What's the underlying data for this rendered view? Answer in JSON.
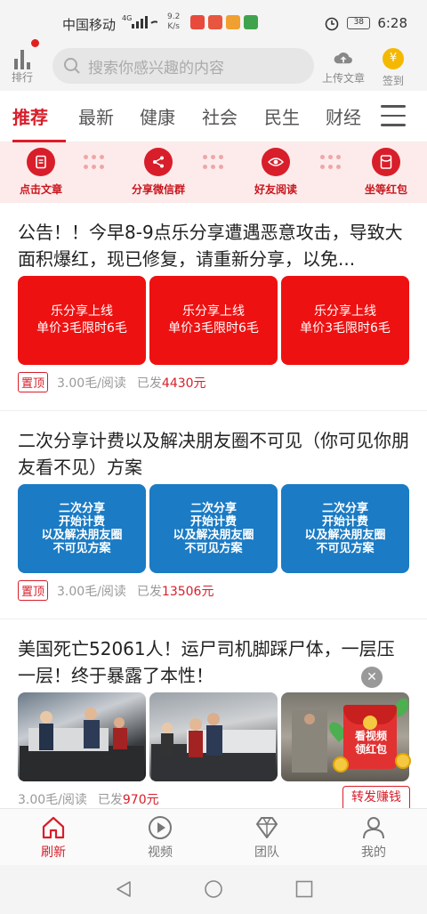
{
  "status_bar": {
    "carrier": "中国移动",
    "signal": "4G",
    "net_speed": "9.2",
    "net_unit": "K/s",
    "battery": "38",
    "time": "6:28"
  },
  "header": {
    "rank_label": "排行",
    "search_placeholder": "搜索你感兴趣的内容",
    "upload_label": "上传文章",
    "signin_label": "签到",
    "coin_symbol": "¥"
  },
  "tabs": [
    {
      "label": "推荐"
    },
    {
      "label": "最新"
    },
    {
      "label": "健康"
    },
    {
      "label": "社会"
    },
    {
      "label": "民生"
    },
    {
      "label": "财经"
    }
  ],
  "quick_actions": [
    {
      "label": "点击文章",
      "icon": "document-icon"
    },
    {
      "label": "分享微信群",
      "icon": "share-icon"
    },
    {
      "label": "好友阅读",
      "icon": "eye-icon"
    },
    {
      "label": "坐等红包",
      "icon": "redpacket-icon"
    }
  ],
  "articles": [
    {
      "title": "公告！！今早8-9点乐分享遭遇恶意攻击，导致大面积爆红，现已修复，请重新分享，以免...",
      "thumb_text": "乐分享上线\n单价3毛限时6毛",
      "pinned_label": "置顶",
      "price": "3.00毛/阅读",
      "paid_prefix": "已发",
      "paid_amount": "4430元"
    },
    {
      "title": "二次分享计费以及解决朋友圈不可见（你可见你朋友看不见）方案",
      "thumb_text": "二次分享\n开始计费\n以及解决朋友圈\n不可见方案",
      "pinned_label": "置顶",
      "price": "3.00毛/阅读",
      "paid_prefix": "已发",
      "paid_amount": "13506元"
    },
    {
      "title": "美国死亡52061人！运尸司机脚踩尸体，一层压一层！终于暴露了本性！",
      "price": "3.00毛/阅读",
      "paid_prefix": "已发",
      "paid_amount": "970元",
      "forward_label": "转发赚钱"
    }
  ],
  "float_ad": {
    "close": "✕",
    "label": "看视频\n领红包"
  },
  "bottom_nav": [
    {
      "label": "刷新",
      "icon": "home-icon"
    },
    {
      "label": "视频",
      "icon": "play-icon"
    },
    {
      "label": "团队",
      "icon": "diamond-icon"
    },
    {
      "label": "我的",
      "icon": "user-icon"
    }
  ],
  "colors": {
    "accent": "#d81e2a",
    "thumb_red": "#ee1111",
    "thumb_blue": "#1b7bc4"
  }
}
